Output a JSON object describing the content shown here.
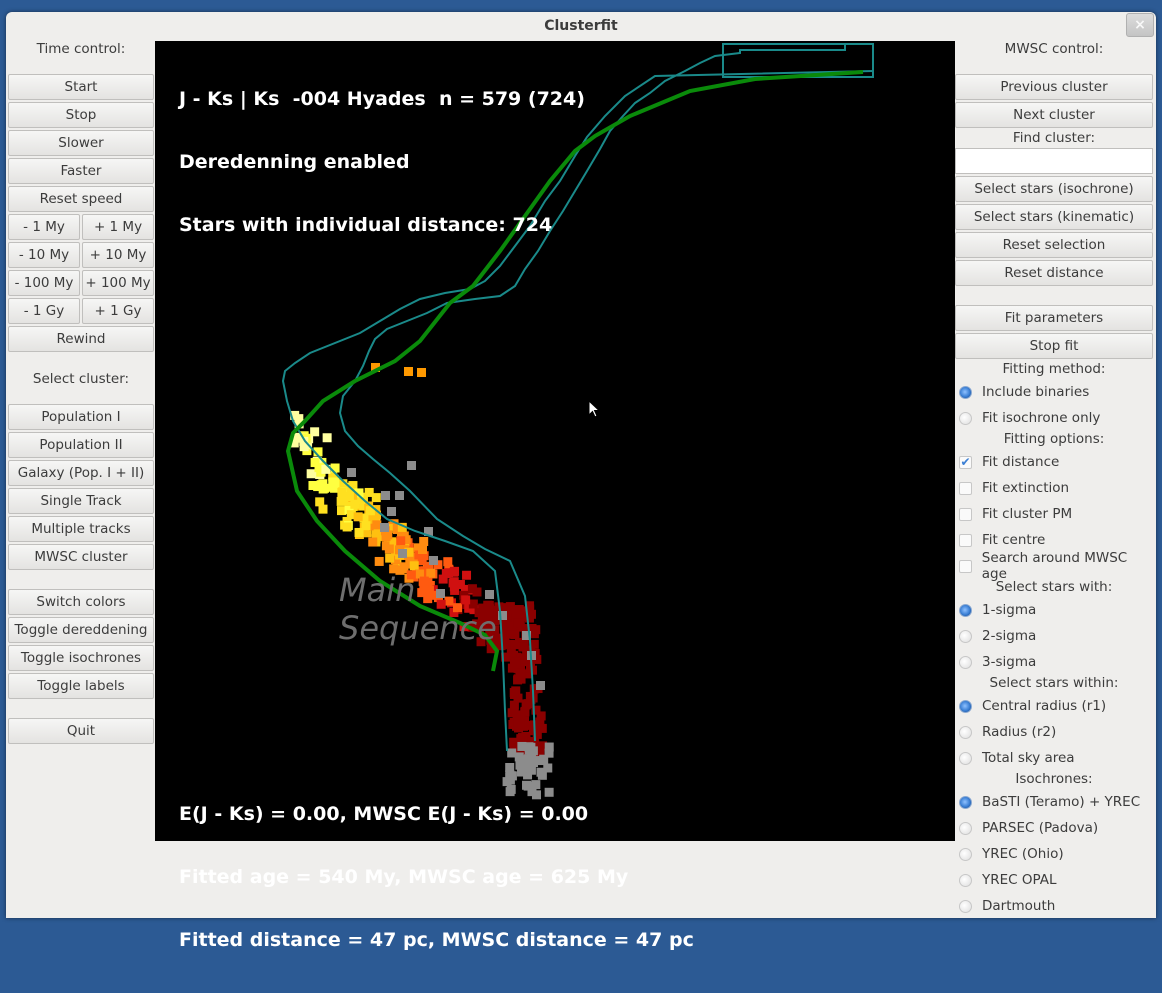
{
  "window": {
    "title": "Clusterfit",
    "close_icon": "×"
  },
  "left_panel": {
    "time_label": "Time control:",
    "time_buttons": [
      "Start",
      "Stop",
      "Slower",
      "Faster",
      "Reset speed"
    ],
    "step_buttons": [
      [
        "- 1 My",
        "+ 1 My"
      ],
      [
        "- 10 My",
        "+ 10 My"
      ],
      [
        "- 100 My",
        "+ 100 My"
      ],
      [
        "- 1 Gy",
        "+ 1 Gy"
      ]
    ],
    "rewind": "Rewind",
    "select_label": "Select cluster:",
    "cluster_buttons": [
      "Population I",
      "Population II",
      "Galaxy (Pop. I + II)",
      "Single Track",
      "Multiple tracks",
      "MWSC cluster"
    ],
    "display_buttons": [
      "Switch colors",
      "Toggle dereddening",
      "Toggle isochrones",
      "Toggle labels"
    ],
    "quit": "Quit"
  },
  "plot": {
    "header_lines": [
      "J - Ks | Ks  -004 Hyades  n = 579 (724)",
      "Deredenning enabled",
      "Stars with individual distance: 724"
    ],
    "footer_lines": [
      "E(J - Ks) = 0.00, MWSC E(J - Ks) = 0.00",
      "Fitted age = 540 My, MWSC age = 625 My",
      "Fitted distance = 47 pc, MWSC distance = 47 pc"
    ],
    "region_label": [
      "Main",
      "Sequence"
    ],
    "colors": {
      "isochrone": "#0a8a0a",
      "envelope": "#1a8a8a",
      "background": "#000000"
    }
  },
  "right_panel": {
    "mwsc_label": "MWSC control:",
    "prev": "Previous cluster",
    "next": "Next cluster",
    "find_label": "Find cluster:",
    "find_value": "",
    "select_buttons": [
      "Select stars (isochrone)",
      "Select stars (kinematic)",
      "Reset selection",
      "Reset distance"
    ],
    "fit_buttons": [
      "Fit parameters",
      "Stop fit"
    ],
    "fitting_method_label": "Fitting method:",
    "fitting_method": [
      {
        "label": "Include binaries",
        "checked": true
      },
      {
        "label": "Fit isochrone only",
        "checked": false
      }
    ],
    "fitting_options_label": "Fitting options:",
    "fitting_options": [
      {
        "label": "Fit distance",
        "checked": true
      },
      {
        "label": "Fit extinction",
        "checked": false
      },
      {
        "label": "Fit cluster PM",
        "checked": false
      },
      {
        "label": "Fit centre",
        "checked": false
      },
      {
        "label": "Search around MWSC age",
        "checked": false
      }
    ],
    "sigma_label": "Select stars with:",
    "sigma": [
      {
        "label": "1-sigma",
        "checked": true
      },
      {
        "label": "2-sigma",
        "checked": false
      },
      {
        "label": "3-sigma",
        "checked": false
      }
    ],
    "within_label": "Select stars within:",
    "within": [
      {
        "label": "Central radius (r1)",
        "checked": true
      },
      {
        "label": "Radius (r2)",
        "checked": false
      },
      {
        "label": "Total sky area",
        "checked": false
      }
    ],
    "iso_label": "Isochrones:",
    "isochrones": [
      {
        "label": "BaSTI (Teramo) + YREC",
        "checked": true
      },
      {
        "label": "PARSEC (Padova)",
        "checked": false
      },
      {
        "label": "YREC (Ohio)",
        "checked": false
      },
      {
        "label": "YREC OPAL",
        "checked": false
      },
      {
        "label": "Dartmouth",
        "checked": false
      }
    ]
  }
}
